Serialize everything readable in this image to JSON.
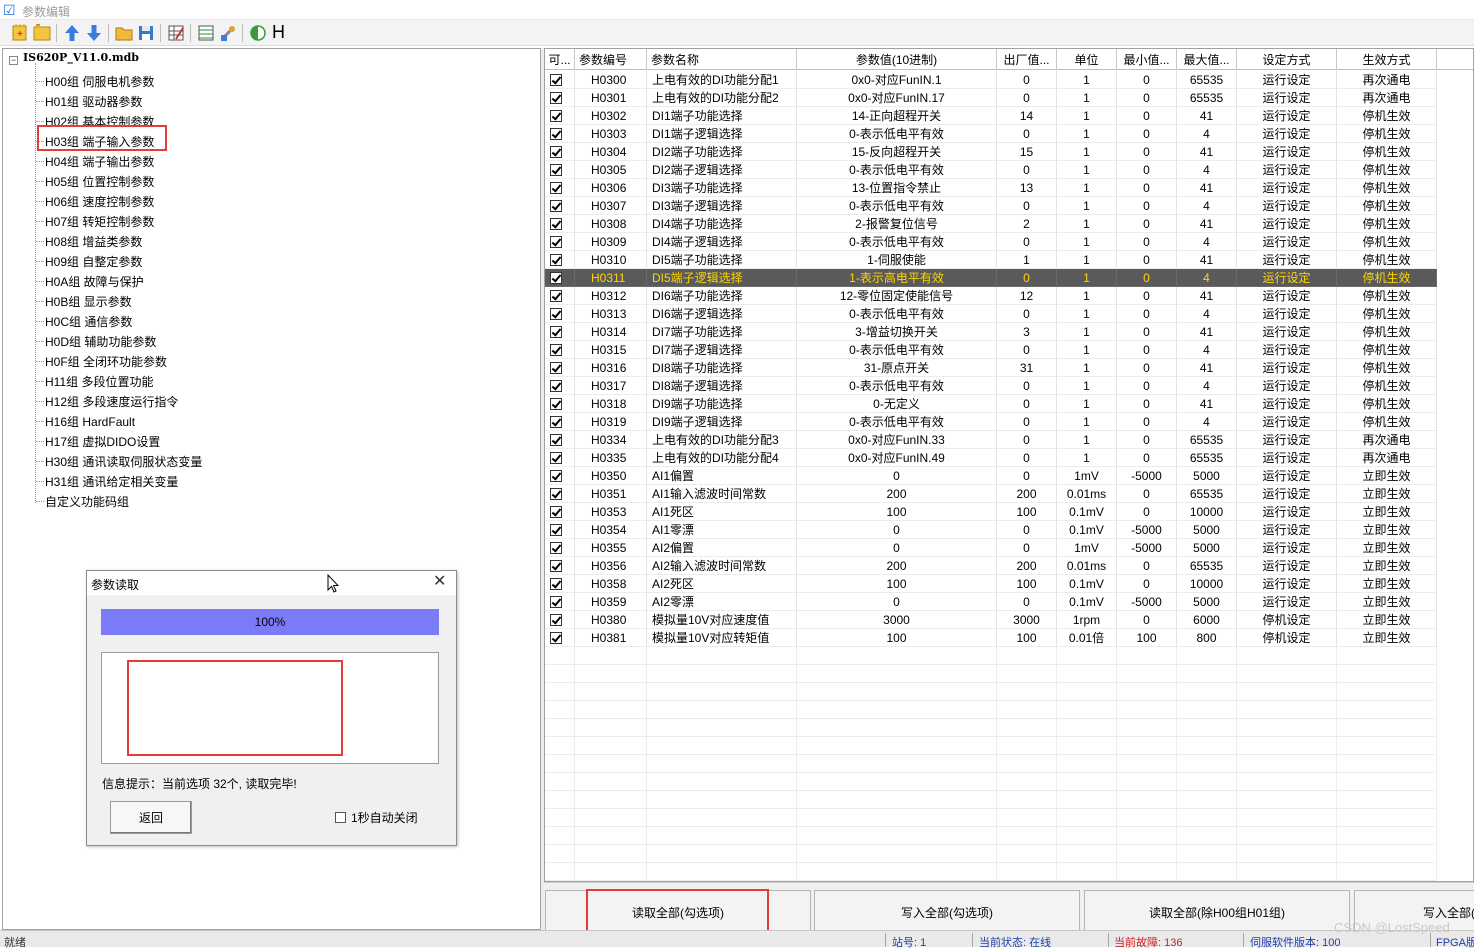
{
  "window": {
    "title": "参数编辑"
  },
  "toolbar": {
    "h_label": "H"
  },
  "tree": {
    "root": "IS620P_V11.0.mdb",
    "expander": "−",
    "items": [
      "H00组 伺服电机参数",
      "H01组 驱动器参数",
      "H02组 基本控制参数",
      "H03组 端子输入参数",
      "H04组 端子输出参数",
      "H05组 位置控制参数",
      "H06组 速度控制参数",
      "H07组 转矩控制参数",
      "H08组 增益类参数",
      "H09组 自整定参数",
      "H0A组 故障与保护",
      "H0B组 显示参数",
      "H0C组 通信参数",
      "H0D组 辅助功能参数",
      "H0F组 全闭环功能参数",
      "H11组 多段位置功能",
      "H12组 多段速度运行指令",
      "H16组 HardFault",
      "H17组 虚拟DIDO设置",
      "H30组 通讯读取伺服状态变量",
      "H31组 通讯给定相关变量",
      "自定义功能码组"
    ]
  },
  "table": {
    "columns": [
      "可...",
      "参数编号",
      "参数名称",
      "参数值(10进制)",
      "出厂值...",
      "单位",
      "最小值...",
      "最大值...",
      "设定方式",
      "生效方式"
    ],
    "selected_index": 11,
    "rows": [
      [
        "H0300",
        "上电有效的DI功能分配1",
        "0x0-对应FunIN.1",
        "0",
        "1",
        "0",
        "65535",
        "运行设定",
        "再次通电"
      ],
      [
        "H0301",
        "上电有效的DI功能分配2",
        "0x0-对应FunIN.17",
        "0",
        "1",
        "0",
        "65535",
        "运行设定",
        "再次通电"
      ],
      [
        "H0302",
        "DI1端子功能选择",
        "14-正向超程开关",
        "14",
        "1",
        "0",
        "41",
        "运行设定",
        "停机生效"
      ],
      [
        "H0303",
        "DI1端子逻辑选择",
        "0-表示低电平有效",
        "0",
        "1",
        "0",
        "4",
        "运行设定",
        "停机生效"
      ],
      [
        "H0304",
        "DI2端子功能选择",
        "15-反向超程开关",
        "15",
        "1",
        "0",
        "41",
        "运行设定",
        "停机生效"
      ],
      [
        "H0305",
        "DI2端子逻辑选择",
        "0-表示低电平有效",
        "0",
        "1",
        "0",
        "4",
        "运行设定",
        "停机生效"
      ],
      [
        "H0306",
        "DI3端子功能选择",
        "13-位置指令禁止",
        "13",
        "1",
        "0",
        "41",
        "运行设定",
        "停机生效"
      ],
      [
        "H0307",
        "DI3端子逻辑选择",
        "0-表示低电平有效",
        "0",
        "1",
        "0",
        "4",
        "运行设定",
        "停机生效"
      ],
      [
        "H0308",
        "DI4端子功能选择",
        "2-报警复位信号",
        "2",
        "1",
        "0",
        "41",
        "运行设定",
        "停机生效"
      ],
      [
        "H0309",
        "DI4端子逻辑选择",
        "0-表示低电平有效",
        "0",
        "1",
        "0",
        "4",
        "运行设定",
        "停机生效"
      ],
      [
        "H0310",
        "DI5端子功能选择",
        "1-伺服使能",
        "1",
        "1",
        "0",
        "41",
        "运行设定",
        "停机生效"
      ],
      [
        "H0311",
        "DI5端子逻辑选择",
        "1-表示高电平有效",
        "0",
        "1",
        "0",
        "4",
        "运行设定",
        "停机生效"
      ],
      [
        "H0312",
        "DI6端子功能选择",
        "12-零位固定使能信号",
        "12",
        "1",
        "0",
        "41",
        "运行设定",
        "停机生效"
      ],
      [
        "H0313",
        "DI6端子逻辑选择",
        "0-表示低电平有效",
        "0",
        "1",
        "0",
        "4",
        "运行设定",
        "停机生效"
      ],
      [
        "H0314",
        "DI7端子功能选择",
        "3-增益切换开关",
        "3",
        "1",
        "0",
        "41",
        "运行设定",
        "停机生效"
      ],
      [
        "H0315",
        "DI7端子逻辑选择",
        "0-表示低电平有效",
        "0",
        "1",
        "0",
        "4",
        "运行设定",
        "停机生效"
      ],
      [
        "H0316",
        "DI8端子功能选择",
        "31-原点开关",
        "31",
        "1",
        "0",
        "41",
        "运行设定",
        "停机生效"
      ],
      [
        "H0317",
        "DI8端子逻辑选择",
        "0-表示低电平有效",
        "0",
        "1",
        "0",
        "4",
        "运行设定",
        "停机生效"
      ],
      [
        "H0318",
        "DI9端子功能选择",
        "0-无定义",
        "0",
        "1",
        "0",
        "41",
        "运行设定",
        "停机生效"
      ],
      [
        "H0319",
        "DI9端子逻辑选择",
        "0-表示低电平有效",
        "0",
        "1",
        "0",
        "4",
        "运行设定",
        "停机生效"
      ],
      [
        "H0334",
        "上电有效的DI功能分配3",
        "0x0-对应FunIN.33",
        "0",
        "1",
        "0",
        "65535",
        "运行设定",
        "再次通电"
      ],
      [
        "H0335",
        "上电有效的DI功能分配4",
        "0x0-对应FunIN.49",
        "0",
        "1",
        "0",
        "65535",
        "运行设定",
        "再次通电"
      ],
      [
        "H0350",
        "AI1偏置",
        "0",
        "0",
        "1mV",
        "-5000",
        "5000",
        "运行设定",
        "立即生效"
      ],
      [
        "H0351",
        "AI1输入滤波时间常数",
        "200",
        "200",
        "0.01ms",
        "0",
        "65535",
        "运行设定",
        "立即生效"
      ],
      [
        "H0353",
        "AI1死区",
        "100",
        "100",
        "0.1mV",
        "0",
        "10000",
        "运行设定",
        "立即生效"
      ],
      [
        "H0354",
        "AI1零漂",
        "0",
        "0",
        "0.1mV",
        "-5000",
        "5000",
        "运行设定",
        "立即生效"
      ],
      [
        "H0355",
        "AI2偏置",
        "0",
        "0",
        "1mV",
        "-5000",
        "5000",
        "运行设定",
        "立即生效"
      ],
      [
        "H0356",
        "AI2输入滤波时间常数",
        "200",
        "200",
        "0.01ms",
        "0",
        "65535",
        "运行设定",
        "立即生效"
      ],
      [
        "H0358",
        "AI2死区",
        "100",
        "100",
        "0.1mV",
        "0",
        "10000",
        "运行设定",
        "立即生效"
      ],
      [
        "H0359",
        "AI2零漂",
        "0",
        "0",
        "0.1mV",
        "-5000",
        "5000",
        "运行设定",
        "立即生效"
      ],
      [
        "H0380",
        "模拟量10V对应速度值",
        "3000",
        "3000",
        "1rpm",
        "0",
        "6000",
        "停机设定",
        "立即生效"
      ],
      [
        "H0381",
        "模拟量10V对应转矩值",
        "100",
        "100",
        "0.01倍",
        "100",
        "800",
        "停机设定",
        "立即生效"
      ]
    ]
  },
  "buttons": {
    "read_all_checked": "读取全部(勾选项)",
    "write_all_checked": "写入全部(勾选项)",
    "read_all_except": "读取全部(除H00组H01组)",
    "write_all": "写入全部("
  },
  "dialog": {
    "title": "参数读取",
    "progress_label": "100%",
    "progress_fraction": 1.0,
    "message": "信息提示：当前选项 32个, 读取完毕!",
    "back_label": "返回",
    "auto_close_label": "1秒自动关闭"
  },
  "status": {
    "left": "就绪",
    "station": "站号: 1",
    "current_state": "当前状态: 在线",
    "current_fault": "当前故障: 136",
    "servo_version": "伺服软件版本: 100",
    "fpga": "FPGA版"
  },
  "watermark": "CSDN @LostSpeed",
  "colors": {
    "selected_row_bg": "#5a5a5a",
    "selected_row_fg": "#ffd400",
    "progress": "#7b7bf8",
    "highlight_box": "#e43b3b",
    "status_fault": "#d32020"
  }
}
